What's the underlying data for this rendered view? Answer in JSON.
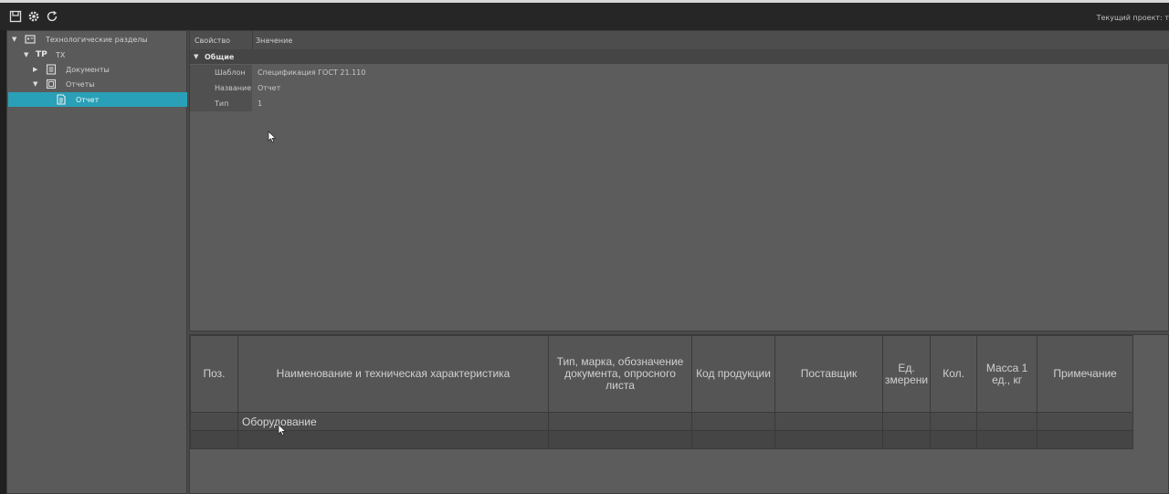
{
  "toolbar": {
    "icons": [
      "save-icon",
      "gear-icon",
      "refresh-icon"
    ],
    "project_label": "Текущий проект: т"
  },
  "tree": {
    "root": {
      "label": "Технологические разделы",
      "icon": "folder-tree-icon"
    },
    "tp": {
      "code": "ТР",
      "label": "ТХ"
    },
    "documents": {
      "label": "Документы",
      "icon": "documents-icon"
    },
    "reports": {
      "label": "Отчеты",
      "icon": "reports-icon"
    },
    "report": {
      "label": "Отчет",
      "icon": "report-icon"
    }
  },
  "properties": {
    "header": {
      "property": "Свойство",
      "value": "Значение"
    },
    "group": "Общие",
    "rows": [
      {
        "name": "Шаблон",
        "value": "Спецификация ГОСТ 21.110"
      },
      {
        "name": "Название",
        "value": "Отчет"
      },
      {
        "name": "Тип",
        "value": "1"
      }
    ]
  },
  "spec_table": {
    "headers": [
      "Поз.",
      "Наименование и техническая характеристика",
      "Тип, марка, обозначение документа, опросного листа",
      "Код продукции",
      "Поставщик",
      "Ед. змерени",
      "Кол.",
      "Масса 1 ед., кг",
      "Примечание"
    ],
    "rows": [
      [
        "",
        "Оборудование",
        "",
        "",
        "",
        "",
        "",
        "",
        ""
      ],
      [
        "",
        "",
        "",
        "",
        "",
        "",
        "",
        "",
        ""
      ]
    ]
  },
  "colors": {
    "selection": "#2aa0b8",
    "toolbar_bg": "#262626",
    "panel_bg": "#5c5c5c"
  }
}
